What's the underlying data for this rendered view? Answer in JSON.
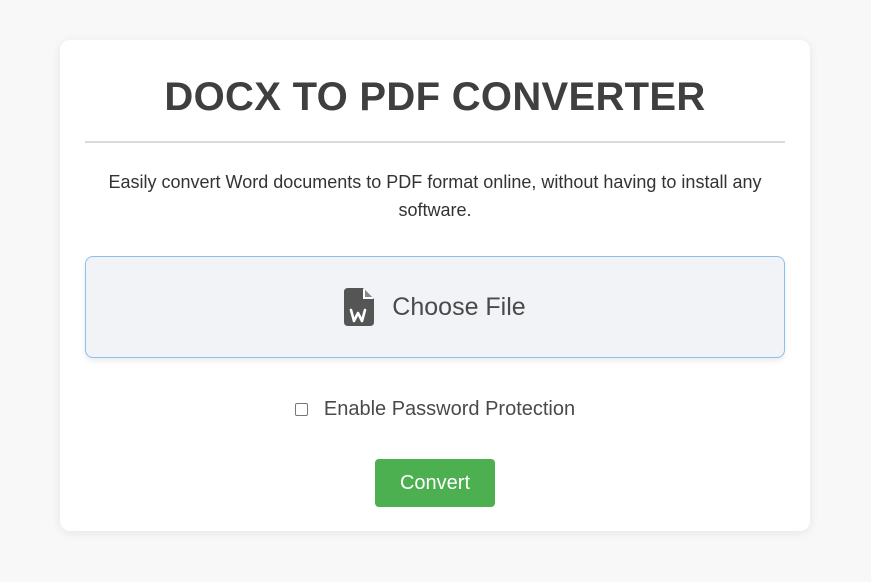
{
  "header": {
    "title": "DOCX TO PDF CONVERTER"
  },
  "main": {
    "description": "Easily convert Word documents to PDF format online, without having to install any software.",
    "file_input": {
      "icon": "word-document-icon",
      "label": "Choose File"
    },
    "password_option": {
      "label": "Enable Password Protection",
      "checked": false
    },
    "convert_button": {
      "label": "Convert"
    }
  },
  "colors": {
    "page_background": "#f8f8f8",
    "card_background": "#ffffff",
    "title_text": "#3f3f3f",
    "file_input_background": "#f1f3f6",
    "file_input_border": "#8cc0ea",
    "button_background": "#4caf50",
    "button_text": "#ffffff"
  }
}
